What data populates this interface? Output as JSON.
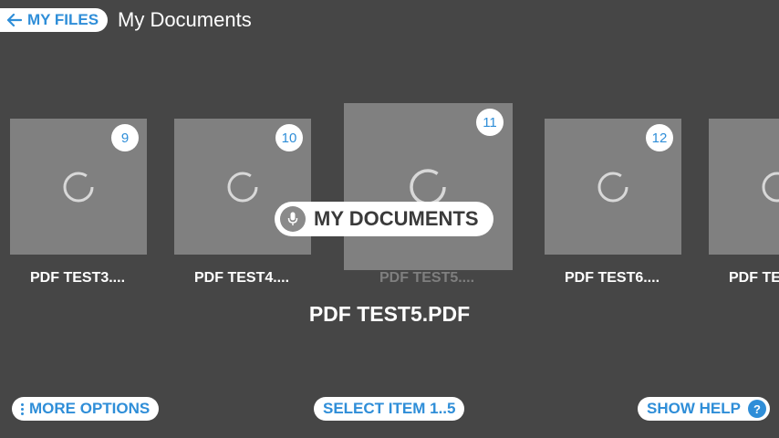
{
  "header": {
    "back_label": "MY FILES",
    "title": "My Documents"
  },
  "carousel": {
    "items": [
      {
        "number": "9",
        "label": "PDF TEST3...."
      },
      {
        "number": "10",
        "label": "PDF TEST4...."
      },
      {
        "number": "11",
        "label": "PDF TEST5...."
      },
      {
        "number": "12",
        "label": "PDF TEST6...."
      },
      {
        "number": "",
        "label": "PDF TE"
      }
    ]
  },
  "voice_command": "MY DOCUMENTS",
  "focused_name": "PDF TEST5.PDF",
  "footer": {
    "more_options": "MORE OPTIONS",
    "select_item": "SELECT ITEM 1..5",
    "show_help": "SHOW HELP",
    "help_symbol": "?"
  },
  "colors": {
    "background": "#464646",
    "tile": "#808080",
    "accent": "#2f8ed8",
    "pill": "#ffffff"
  },
  "icons": [
    "back-arrow-icon",
    "loading-spinner-icon",
    "microphone-icon",
    "more-vertical-icon",
    "help-icon"
  ]
}
